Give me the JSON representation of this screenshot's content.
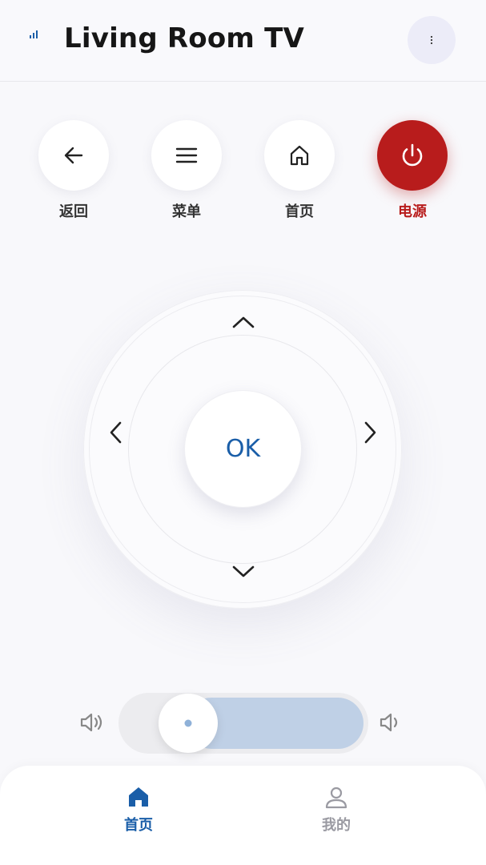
{
  "header": {
    "title": "Living Room TV",
    "signal_icon": "signal-bars-icon",
    "menu_icon": "more-vertical-icon"
  },
  "quick_actions": [
    {
      "label": "返回",
      "icon": "arrow-left-icon"
    },
    {
      "label": "菜单",
      "icon": "menu-icon"
    },
    {
      "label": "首页",
      "icon": "home-icon"
    },
    {
      "label": "电源",
      "icon": "power-icon"
    }
  ],
  "dpad": {
    "ok_label": "OK"
  },
  "volume": {
    "level": 0.2,
    "down_icon": "volume-down-icon",
    "up_icon": "volume-up-icon"
  },
  "bottom_nav": [
    {
      "label": "首页",
      "icon": "home-filled-icon",
      "active": true
    },
    {
      "label": "我的",
      "icon": "user-icon",
      "active": false
    }
  ],
  "colors": {
    "accent": "#1a5ea8",
    "power": "#b81c1c",
    "volume_fill": "#bfd0e6"
  }
}
